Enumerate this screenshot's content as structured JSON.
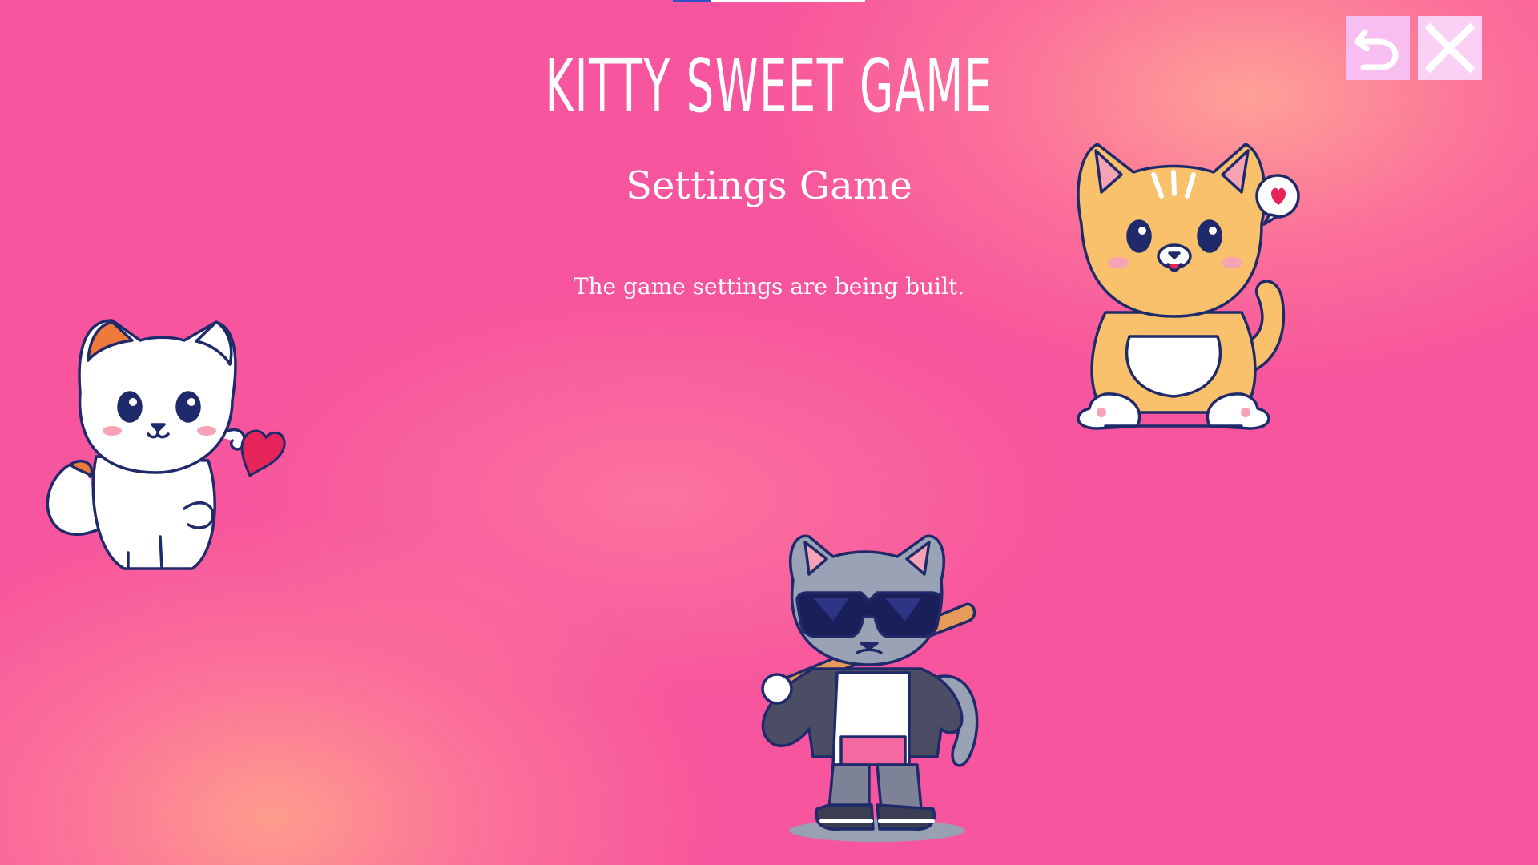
{
  "header": {
    "title": "KITTY SWEET GAME",
    "subtitle": "Settings Game"
  },
  "main": {
    "message": "The game settings are being built."
  },
  "controls": {
    "back_icon": "undo-arrow-icon",
    "close_icon": "close-x-icon"
  },
  "illustrations": [
    {
      "name": "white-cat-heart",
      "description_icon": "white cat with heart"
    },
    {
      "name": "orange-cat-sitting",
      "description_icon": "orange tabby cat with love bubble"
    },
    {
      "name": "cool-cat-bat",
      "description_icon": "grey cat with sunglasses and bat"
    }
  ],
  "colors": {
    "background": "#f7559d",
    "background_glow": "#ffa090",
    "text": "#ffffff",
    "back_button": "#f6bef1",
    "close_button": "#fad0f4",
    "outline": "#1f2a6b"
  }
}
